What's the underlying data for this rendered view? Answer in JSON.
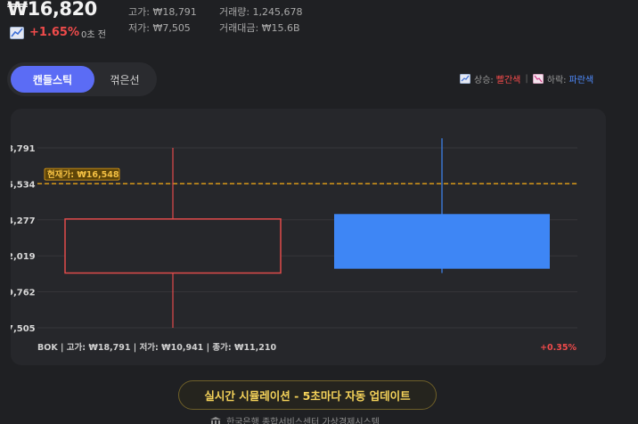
{
  "header": {
    "price": "₩16,820",
    "trend_icon": "chart-line-icon",
    "change": "+1.65%",
    "age": "0초 전",
    "high": "고가: ₩18,791",
    "low": "저가: ₩7,505",
    "volume": "거래량: 1,245,678",
    "amount": "거래대금: ₩15.6B"
  },
  "tabs": [
    {
      "label": "캔들스틱",
      "active": true
    },
    {
      "label": "꺾은선",
      "active": false
    }
  ],
  "legend": {
    "up_prefix": "상승:",
    "up_color_name": "빨간색",
    "separator": "|",
    "down_prefix": "하락:",
    "down_color_name": "파란색"
  },
  "chart_data": {
    "type": "candlestick",
    "y_ticks": [
      "8,791",
      "5,534",
      "4,277",
      "2,019",
      "9,762",
      "7,505"
    ],
    "current_price_label": "현재가: ₩16,548",
    "current_price": 16548,
    "candles": [
      {
        "open": 14330,
        "close": 10941,
        "high": 18791,
        "low": 7505,
        "direction": "up",
        "fill": false
      },
      {
        "open": 11210,
        "close": 14640,
        "high": 19390,
        "low": 10941,
        "direction": "down",
        "fill": true
      }
    ],
    "info": "BOK | 고가: ₩18,791 | 저가: ₩10,941 | 종가: ₩11,210",
    "info_change": "+0.35%",
    "grid": true,
    "colors": {
      "up": "#e14b4b",
      "down": "#3e86f5",
      "current_line": "#e8a317",
      "grid": "#36373b"
    }
  },
  "simulation": {
    "label": "실시간 시뮬레이션 - 5초마다 자동 업데이트"
  },
  "footer": {
    "icon": "bank-icon",
    "text": "한국은행 종합서비스센터 가상경제시스템"
  }
}
